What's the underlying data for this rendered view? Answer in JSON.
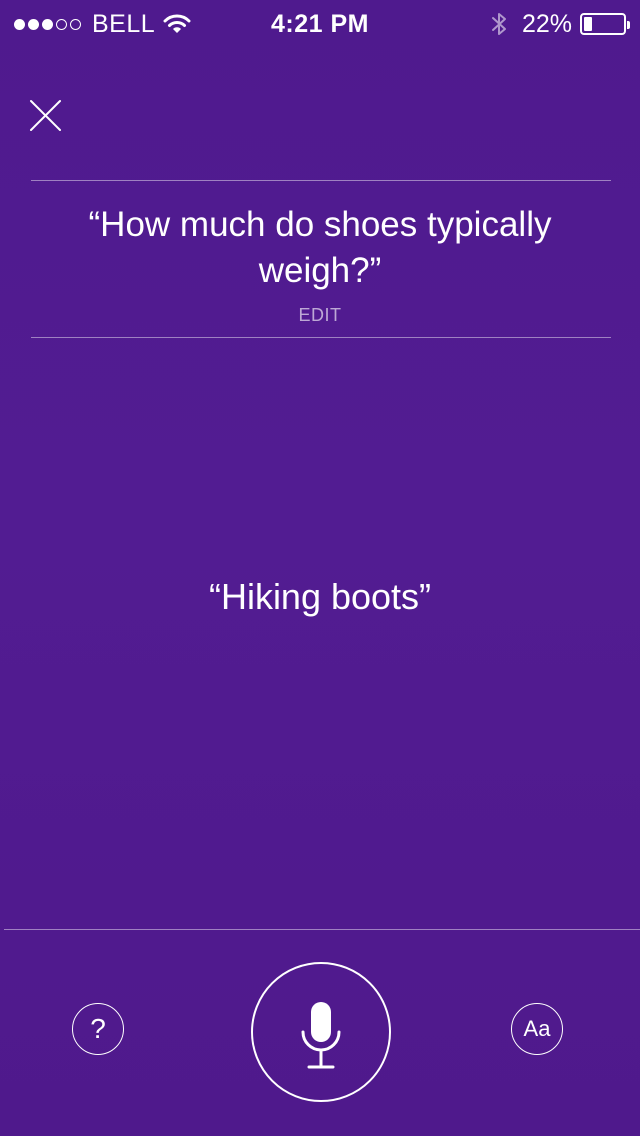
{
  "status_bar": {
    "carrier": "BELL",
    "time": "4:21 PM",
    "battery_percent_label": "22%",
    "battery_level": 0.22,
    "signal_bars_filled": 3,
    "signal_bars_total": 5,
    "icons": [
      "wifi-icon",
      "bluetooth-icon",
      "battery-icon"
    ]
  },
  "close": {
    "icon": "close-icon"
  },
  "query": {
    "text": "“How much do shoes typically weigh?”",
    "edit_label": "EDIT"
  },
  "response": {
    "text": "“Hiking boots”"
  },
  "controls": {
    "help_label": "?",
    "mic_icon": "microphone-icon",
    "text_label": "Aa"
  },
  "colors": {
    "background": "#521c92",
    "foreground": "#ffffff"
  }
}
